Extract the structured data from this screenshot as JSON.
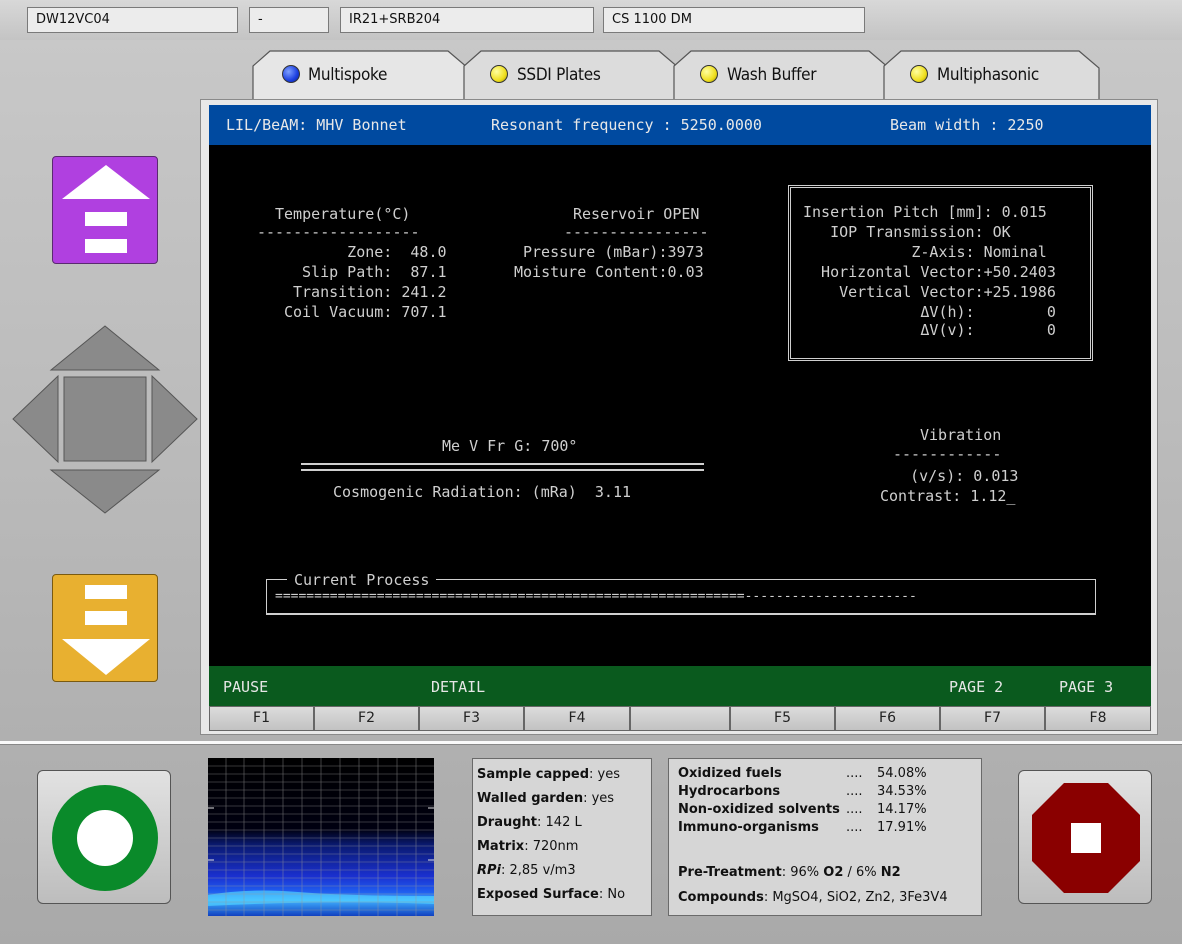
{
  "header": {
    "fields": [
      "DW12VC04",
      "-",
      "IR21+SRB204",
      "CS 1100 DM"
    ]
  },
  "tabs": [
    {
      "label": "Multispoke",
      "dot_color": "#1b3fe0",
      "active": true
    },
    {
      "label": "SSDI Plates",
      "dot_color": "#f0e020",
      "active": false
    },
    {
      "label": "Wash Buffer",
      "dot_color": "#f0e020",
      "active": false
    },
    {
      "label": "Multiphasonic",
      "dot_color": "#f0e020",
      "active": false
    }
  ],
  "screen": {
    "status": {
      "left": "LIL/BeAM: MHV Bonnet",
      "center": "Resonant frequency : 5250.0000",
      "right": "Beam width : 2250"
    },
    "temperature": {
      "title": "Temperature(°C)",
      "rule": "------------------",
      "rows": [
        "      Zone:  48.0",
        " Slip Path:  87.1",
        "Transition: 241.2",
        "Coil Vacuum: 707.1"
      ]
    },
    "reservoir": {
      "title": "Reservoir OPEN",
      "rule": "----------------",
      "rows": [
        "Pressure (mBar):3973",
        "Moisture Content:0.03"
      ]
    },
    "insertion": {
      "rows": [
        "Insertion Pitch [mm]: 0.015",
        "   IOP Transmission: OK",
        "            Z-Axis: Nominal",
        "  Horizontal Vector:+50.2403",
        "    Vertical Vector:+25.1986",
        "             ΔV(h):        0",
        "             ΔV(v):        0"
      ]
    },
    "me": {
      "title": "Me V Fr G: 700°",
      "radiation": "Cosmogenic Radiation: (mRa)  3.11"
    },
    "vibration": {
      "title": "Vibration",
      "rule": "------------",
      "rows": [
        "   (v/s): 0.013",
        "Contrast: 1.12_"
      ]
    },
    "process": {
      "title": "Current Process",
      "bar": "============================================================----------------------"
    },
    "softkeys": {
      "pause": "PAUSE",
      "detail": "DETAIL",
      "page2": "PAGE 2",
      "page3": "PAGE 3"
    }
  },
  "fkeys": [
    "F1",
    "F2",
    "F3",
    "F4",
    "",
    "F5",
    "F6",
    "F7",
    "F8"
  ],
  "info_panel": {
    "rows": [
      {
        "label": "Sample capped",
        "value": ": yes"
      },
      {
        "label": "Walled garden",
        "value": ": yes"
      },
      {
        "label": "Draught",
        "value": ": 142 L"
      },
      {
        "label": "Matrix",
        "value": ": 720nm"
      },
      {
        "label": "RPi",
        "value": ": 2,85 v/m3"
      },
      {
        "label": "Exposed Surface",
        "value": ": No"
      }
    ]
  },
  "composition_panel": {
    "rows": [
      {
        "label": "Oxidized fuels",
        "dots": "....",
        "value": "54.08%"
      },
      {
        "label": "Hydrocarbons",
        "dots": "....",
        "value": "34.53%"
      },
      {
        "label": "Non-oxidized solvents",
        "dots": "....",
        "value": "14.17%"
      },
      {
        "label": "Immuno-organisms",
        "dots": "....",
        "value": "17.91%"
      }
    ],
    "pretreatment": {
      "label": "Pre-Treatment",
      "text": ": 96% ",
      "o2": "O2",
      "sep": " / 6% ",
      "n2": "N2"
    },
    "compounds": {
      "label": "Compounds",
      "value": ": MgSO4, SiO2, Zn2, 3Fe3V4"
    }
  },
  "colors": {
    "up_button": "#b040e0",
    "down_button": "#e8b030",
    "start_button": "#0a8a2a",
    "stop_button": "#8a0000",
    "screen_bar": "#004aa0",
    "softkey_bar": "#0a5a1e"
  }
}
